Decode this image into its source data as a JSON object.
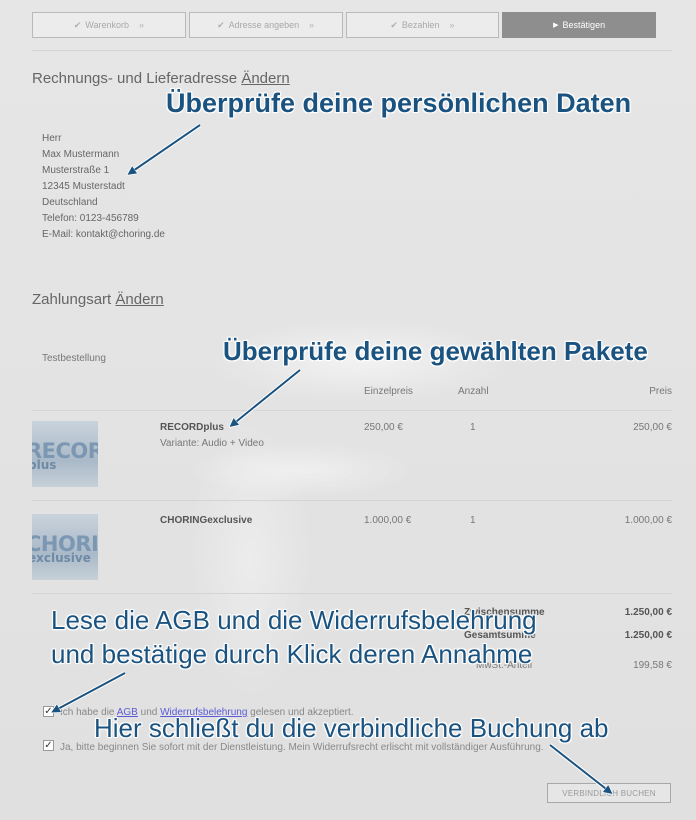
{
  "steps": [
    {
      "label": "Warenkorb",
      "state": "done"
    },
    {
      "label": "Adresse angeben",
      "state": "done"
    },
    {
      "label": "Bezahlen",
      "state": "done"
    },
    {
      "label": "Bestätigen",
      "state": "active"
    }
  ],
  "address_section": {
    "title": "Rechnungs- und Lieferadresse",
    "change_link": "Ändern",
    "lines": [
      "Herr",
      "Max Mustermann",
      "Musterstraße 1",
      "12345 Musterstadt",
      "Deutschland",
      "Telefon: 0123-456789",
      "E-Mail: kontakt@choring.de"
    ]
  },
  "payment_section": {
    "title": "Zahlungsart",
    "change_link": "Ändern",
    "method": "Testbestellung"
  },
  "table": {
    "headers": {
      "unit_price": "Einzelpreis",
      "quantity": "Anzahl",
      "price": "Preis"
    },
    "rows": [
      {
        "name": "RECORDplus",
        "variant": "Variante: Audio + Video",
        "unit_price": "250,00 €",
        "quantity": "1",
        "price": "250,00 €",
        "thumb_line1": "RECORD",
        "thumb_line2": "plus"
      },
      {
        "name": "CHORINGexclusive",
        "variant": "",
        "unit_price": "1.000,00 €",
        "quantity": "1",
        "price": "1.000,00 €",
        "thumb_line1": "CHORING",
        "thumb_line2": "exclusive"
      }
    ]
  },
  "totals": {
    "subtotal_label": "Zwischensumme",
    "subtotal_value": "1.250,00 €",
    "total_label": "Gesamtsumme",
    "total_value": "1.250,00 €",
    "vat_label": "MwSt.-Anteil",
    "vat_value": "199,58 €"
  },
  "consent": {
    "terms_prefix": "Ich habe die",
    "terms_agb": "AGB",
    "terms_und": "und",
    "terms_widerruf": "Widerrufsbelehrung",
    "terms_suffix": "gelesen und akzeptiert.",
    "terms_checked": true,
    "service_text": "Ja, bitte beginnen Sie sofort mit der Dienstleistung. Mein Widerrufsrecht erlischt mit vollständiger Ausführung.",
    "service_checked": true
  },
  "buy_button": "VERBINDLICH BUCHEN",
  "annotations": {
    "personal_data": "Überprüfe deine persönlichen Daten",
    "packages": "Überprüfe deine gewählten Pakete",
    "terms_line1": "Lese die AGB und die Widerrufsbelehrung",
    "terms_line2": "und bestätige durch Klick deren Annahme",
    "booking": "Hier schließt du die verbindliche Buchung ab"
  },
  "colors": {
    "annotation": "#1b5380",
    "active_step": "#8e8e8e",
    "link": "#5b5bd6"
  },
  "icons": [
    "check-icon",
    "play-triangle-icon",
    "right-guillemet-icon",
    "arrow-icon"
  ]
}
